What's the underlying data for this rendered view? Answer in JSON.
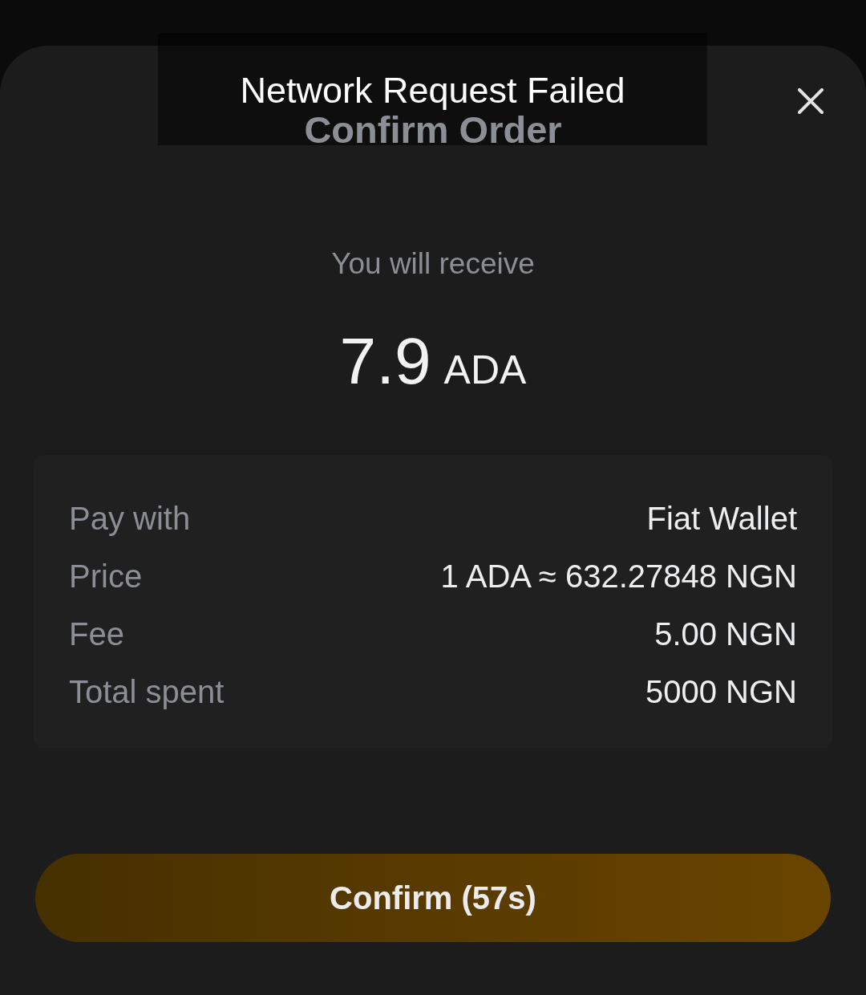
{
  "toast": {
    "message": "Network Request Failed"
  },
  "header": {
    "title": "Confirm Order"
  },
  "receive": {
    "label": "You will receive",
    "amount": "7.9",
    "unit": "ADA"
  },
  "details": [
    {
      "label": "Pay with",
      "value": "Fiat Wallet"
    },
    {
      "label": "Price",
      "value": "1 ADA ≈ 632.27848 NGN"
    },
    {
      "label": "Fee",
      "value": "5.00 NGN"
    },
    {
      "label": "Total spent",
      "value": "5000 NGN"
    }
  ],
  "confirm_button": {
    "label": "Confirm (57s)"
  }
}
